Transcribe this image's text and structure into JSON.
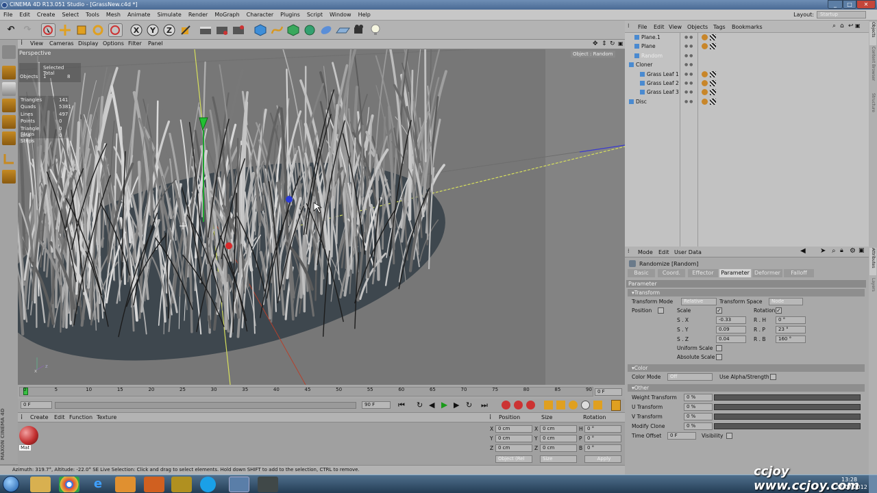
{
  "window": {
    "title": "CINEMA 4D R13.051 Studio - [GrassNew.c4d *]",
    "controls": [
      "minimize",
      "maximize",
      "close"
    ]
  },
  "menubar": {
    "items": [
      "File",
      "Edit",
      "Create",
      "Select",
      "Tools",
      "Mesh",
      "Animate",
      "Simulate",
      "Render",
      "MoGraph",
      "Character",
      "Plugins",
      "Script",
      "Window",
      "Help"
    ],
    "layout_label": "Layout:",
    "layout_value": "Startup"
  },
  "viewport": {
    "menu": [
      "View",
      "Cameras",
      "Display",
      "Options",
      "Filter",
      "Panel"
    ],
    "name": "Perspective",
    "object_label": "Object : Random",
    "stats": {
      "header": "Selected Total",
      "objects_label": "Objects",
      "objects_selected": "1",
      "objects_total": "8",
      "rows": [
        {
          "label": "Triangles",
          "value": "141"
        },
        {
          "label": "Quads",
          "value": "5381"
        },
        {
          "label": "Lines",
          "value": "497"
        },
        {
          "label": "Points",
          "value": "0"
        },
        {
          "label": "Triangle Strips",
          "value": "0"
        },
        {
          "label": "Line Strips",
          "value": "0"
        }
      ]
    }
  },
  "timeline": {
    "ticks": [
      "0",
      "5",
      "10",
      "15",
      "20",
      "25",
      "30",
      "35",
      "40",
      "45",
      "50",
      "55",
      "60",
      "65",
      "70",
      "75",
      "80",
      "85",
      "90"
    ],
    "current_frame": "0 F",
    "start_field": "0 F",
    "end_field": "90 F",
    "max_field": "90 F"
  },
  "material_manager": {
    "menu": [
      "Create",
      "Edit",
      "Function",
      "Texture"
    ],
    "material_label": "Mat"
  },
  "coordinates": {
    "headers": [
      "Position",
      "Size",
      "Rotation"
    ],
    "rows": [
      {
        "axis": "X",
        "pos": "0 cm",
        "size_axis": "X",
        "size": "0 cm",
        "rot_axis": "H",
        "rot": "0 °"
      },
      {
        "axis": "Y",
        "pos": "0 cm",
        "size_axis": "Y",
        "size": "0 cm",
        "rot_axis": "P",
        "rot": "0 °"
      },
      {
        "axis": "Z",
        "pos": "0 cm",
        "size_axis": "Z",
        "size": "0 cm",
        "rot_axis": "B",
        "rot": "0 °"
      }
    ],
    "mode_select": "Object (Rel",
    "size_select": "Size",
    "apply_label": "Apply"
  },
  "brand": "MAXON CINEMA 4D",
  "statusbar": {
    "text": "Azimuth: 319.7°, Altitude: -22.0°  SE   Live Selection: Click and drag to select elements. Hold down SHIFT to add to the selection, CTRL to remove."
  },
  "object_manager": {
    "menu": [
      "File",
      "Edit",
      "View",
      "Objects",
      "Tags",
      "Bookmarks"
    ],
    "objects": [
      {
        "name": "Plane.1",
        "indent": 1
      },
      {
        "name": "Plane",
        "indent": 1
      },
      {
        "name": "Random",
        "indent": 1
      },
      {
        "name": "Cloner",
        "indent": 0
      },
      {
        "name": "Grass Leaf 1",
        "indent": 2
      },
      {
        "name": "Grass Leaf 2",
        "indent": 2
      },
      {
        "name": "Grass Leaf 3",
        "indent": 2
      },
      {
        "name": "Disc",
        "indent": 0
      }
    ]
  },
  "side_tabs_right": [
    "Objects",
    "Content Browser",
    "Structure",
    "Attributes",
    "Layers"
  ],
  "attributes": {
    "menu": [
      "Mode",
      "Edit",
      "User Data"
    ],
    "object_title": "Randomize [Random]",
    "tabs": [
      "Basic",
      "Coord.",
      "Effector",
      "Parameter",
      "Deformer",
      "Falloff"
    ],
    "active_tab": "Parameter",
    "section_title": "Parameter",
    "transform": {
      "header": "Transform",
      "mode_label": "Transform Mode",
      "mode_value": "Relative",
      "space_label": "Transform Space",
      "space_value": "Node",
      "position_label": "Position",
      "scale_label": "Scale",
      "rotation_label": "Rotation",
      "sx_label": "S . X",
      "sx": "-0.33",
      "sy_label": "S . Y",
      "sy": "0.09",
      "sz_label": "S . Z",
      "sz": "0.04",
      "rh_label": "R . H",
      "rh": "0 °",
      "rp_label": "R . P",
      "rp": "23 °",
      "rb_label": "R . B",
      "rb": "160 °",
      "uniform_scale_label": "Uniform Scale",
      "absolute_scale_label": "Absolute Scale"
    },
    "color": {
      "header": "Color",
      "mode_label": "Color Mode",
      "mode_value": "Off",
      "use_alpha_label": "Use Alpha/Strength"
    },
    "other": {
      "header": "Other",
      "rows": [
        {
          "label": "Weight Transform",
          "value": "0 %"
        },
        {
          "label": "U Transform",
          "value": "0 %"
        },
        {
          "label": "V Transform",
          "value": "0 %"
        },
        {
          "label": "Modify Clone",
          "value": "0 %"
        }
      ],
      "time_offset_label": "Time Offset",
      "time_offset_value": "0 F",
      "visibility_label": "Visibility"
    }
  },
  "taskbar": {
    "apps": [
      "start-orb",
      "explorer",
      "chrome",
      "internet-explorer",
      "media-player",
      "file-manager",
      "app-pen",
      "skype",
      "cinema4d",
      "app-tool"
    ],
    "time": "13:28",
    "date": "27.07.2012"
  },
  "watermark": "ccjoy www.ccjoy.com",
  "colors": {
    "title_gradient_top": "#6e8eb5",
    "viewport_bg": "#7a7a7a",
    "disc": "#3e474e",
    "active_tab": "#d6d6d6",
    "axis_y": "#d7e05c",
    "axis_x": "#b5402c",
    "axis_z": "#3a3ad0"
  }
}
